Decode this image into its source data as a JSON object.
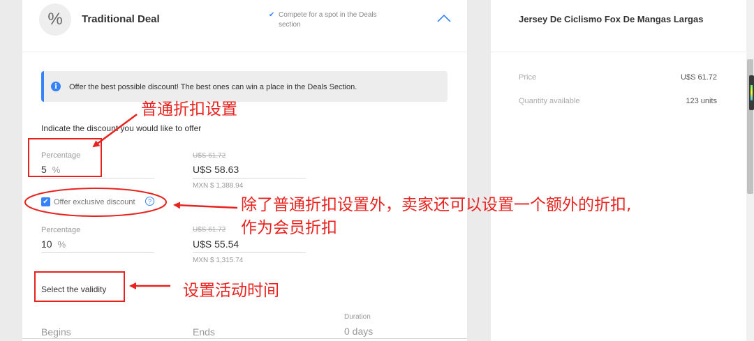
{
  "deal_header": {
    "icon": "percent-icon",
    "icon_glyph": "%",
    "title": "Traditional Deal",
    "compete_text": "Compete for a spot in the Deals section",
    "check_glyph": "✔",
    "collapse_icon": "chevron-up-icon"
  },
  "info": {
    "icon_glyph": "i",
    "text": "Offer the best possible discount! The best ones can win a place in the Deals Section."
  },
  "discount": {
    "indicate_label": "Indicate the discount you would like to offer",
    "percentage_label": "Percentage",
    "percentage_value": "5",
    "unit": "%",
    "old_price": "U$S 61.72",
    "new_price": "U$S 58.63",
    "mxn_price": "MXN $ 1,388.94"
  },
  "exclusive": {
    "checked": true,
    "check_glyph": "✔",
    "label": "Offer exclusive discount",
    "help_glyph": "?",
    "percentage_label": "Percentage",
    "percentage_value": "10",
    "unit": "%",
    "old_price": "U$S 61.72",
    "new_price": "U$S 55.54",
    "mxn_price": "MXN $ 1,315.74"
  },
  "validity": {
    "label": "Select the validity",
    "begins_label": "Begins",
    "ends_label": "Ends",
    "duration_label": "Duration",
    "duration_value": "0 days"
  },
  "product": {
    "title": "Jersey De Ciclismo Fox De Mangas Largas",
    "price_label": "Price",
    "price_value": "U$S 61.72",
    "quantity_label": "Quantity available",
    "quantity_value": "123 units"
  },
  "annotations": {
    "normal_discount": "普通折扣设置",
    "exclusive_line1": "除了普通折扣设置外，卖家还可以设置一个额外的折扣,",
    "exclusive_line2": "作为会员折扣",
    "validity": "设置活动时间"
  },
  "colors": {
    "accent": "#3483fa",
    "annotation": "#e8231f",
    "background": "#ebebeb"
  }
}
